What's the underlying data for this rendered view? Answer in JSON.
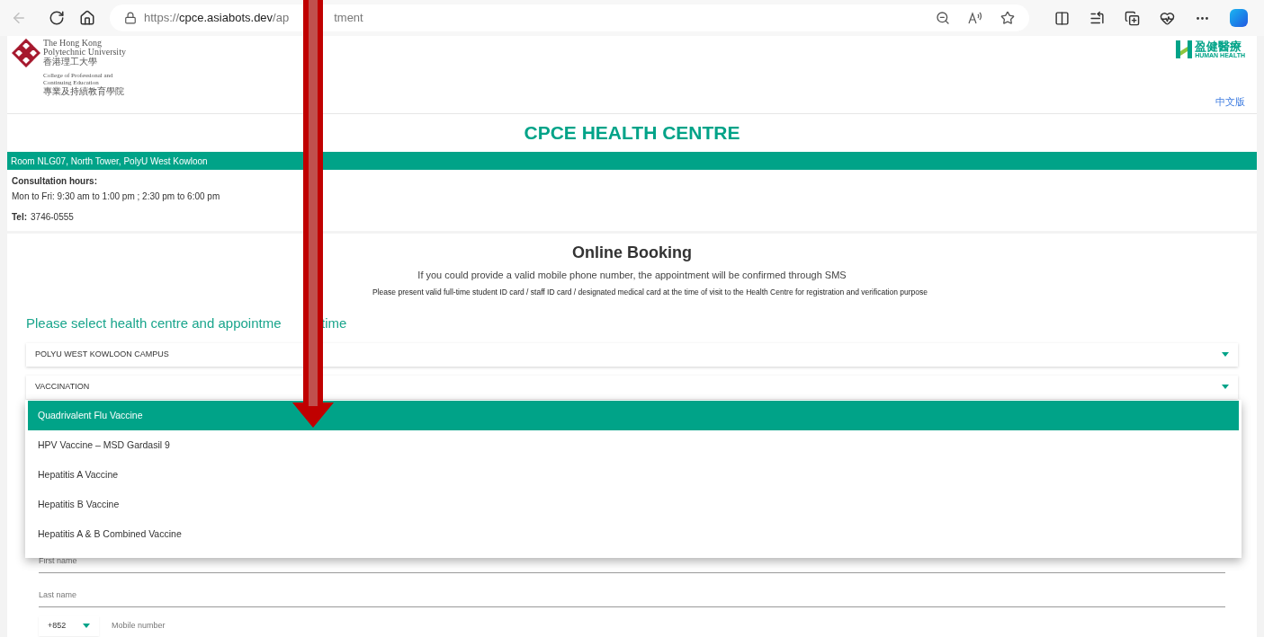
{
  "browser": {
    "url_before_arrow": [
      {
        "text": "https://",
        "strong": false
      },
      {
        "text": "cpce.asiabots.dev",
        "strong": true
      },
      {
        "text": "/ap",
        "strong": false
      }
    ],
    "url_after_arrow": "tment"
  },
  "header": {
    "university_lines": [
      "The Hong Kong",
      "Polytechnic University"
    ],
    "university_chinese": "香港理工大學",
    "college_lines": [
      "College of Professional and",
      "Continuing Education"
    ],
    "college_chinese": "專業及持續教育學院",
    "partner_chinese": "盈健醫療",
    "partner_english": "HUMAN HEALTH",
    "language_link": "中文版"
  },
  "title": "CPCE HEALTH CENTRE",
  "location": "Room NLG07, North Tower, PolyU West Kowloon",
  "hours_label": "Consultation hours:",
  "hours": "Mon to Fri: 9:30 am to 1:00 pm ; 2:30 pm to 6:00 pm",
  "tel_label": "Tel:",
  "tel": "3746-0555",
  "booking": {
    "title": "Online Booking",
    "note": "If you could provide a valid mobile phone number, the appointment will be confirmed through SMS",
    "id_note": "Please present valid full-time student ID card / staff ID card / designated medical card at the time of visit to the Health Centre for registration and verification purpose",
    "heading_before_arrow": "Please select health centre and appointme",
    "heading_after_arrow": "time",
    "selects": [
      "POLYU WEST KOWLOON CAMPUS",
      "VACCINATION"
    ],
    "menu": [
      {
        "label": "Quadrivalent Flu Vaccine",
        "selected": true
      },
      {
        "label": "HPV Vaccine – MSD Gardasil 9",
        "selected": false
      },
      {
        "label": "Hepatitis A Vaccine",
        "selected": false
      },
      {
        "label": "Hepatitis B Vaccine",
        "selected": false
      },
      {
        "label": "Hepatitis A & B Combined Vaccine",
        "selected": false
      }
    ],
    "fields": [
      {
        "placeholder": "First name"
      },
      {
        "placeholder": "Last name"
      }
    ],
    "country_code": "+852",
    "mobile_placeholder": "Mobile number"
  }
}
